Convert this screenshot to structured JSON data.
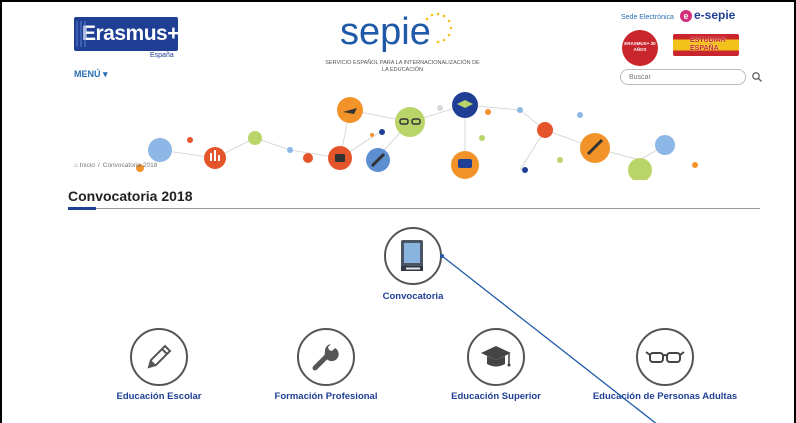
{
  "header": {
    "erasmus_logo": "Erasmus+",
    "erasmus_sub": "España",
    "menu_label": "MENÚ ▾",
    "sepie_logo": "sepie",
    "sepie_tagline": "SERVICIO ESPAÑOL PARA LA INTERNACIONALIZACIÓN DE LA EDUCACIÓN",
    "sede_link": "Sede Electrónica",
    "esepie_logo": "e-sepie",
    "badge_30": "ERASMUS+ 30 AÑOS",
    "estudiar_logo": "ESTUDIAR ESPAÑA",
    "search": {
      "placeholder": "Buscar"
    }
  },
  "breadcrumb": {
    "home": "Inicio",
    "separator": "/",
    "current": "Convocatoria 2018"
  },
  "page_title": "Convocatoria 2018",
  "main_item": {
    "label": "Convocatoria",
    "icon": "book-icon"
  },
  "categories": [
    {
      "label": "Educación Escolar",
      "icon": "pencil-icon"
    },
    {
      "label": "Formación Profesional",
      "icon": "wrench-icon"
    },
    {
      "label": "Educación Superior",
      "icon": "graduation-cap-icon"
    },
    {
      "label": "Educación de Personas Adultas",
      "icon": "glasses-icon"
    }
  ],
  "colors": {
    "brand_blue": "#1f3f95",
    "link_blue": "#2a6fb3",
    "accent_red": "#c8252c",
    "accent_magenta": "#d22e7a",
    "annotation_line": "#1f5aa8"
  }
}
